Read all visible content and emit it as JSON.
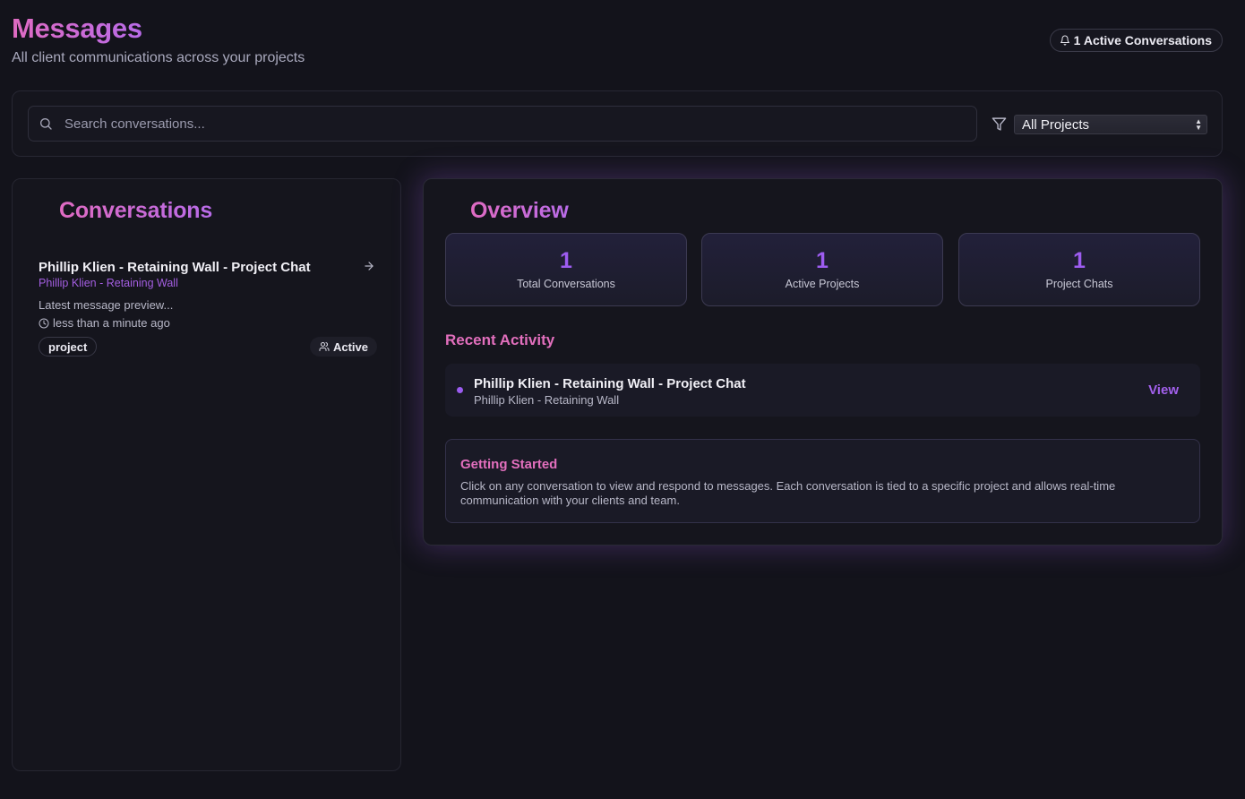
{
  "header": {
    "title": "Messages",
    "subtitle": "All client communications across your projects",
    "active_badge": "1 Active Conversations"
  },
  "search": {
    "placeholder": "Search conversations...",
    "value": "",
    "project_filter": {
      "selected": "All Projects"
    }
  },
  "conversations": {
    "title": "Conversations",
    "items": [
      {
        "title": "Phillip Klien - Retaining Wall - Project Chat",
        "project": "Phillip Klien - Retaining Wall",
        "preview": "Latest message preview...",
        "time": "less than a minute ago",
        "tag": "project",
        "status": "Active"
      }
    ]
  },
  "overview": {
    "title": "Overview",
    "stats": [
      {
        "value": "1",
        "label": "Total Conversations"
      },
      {
        "value": "1",
        "label": "Active Projects"
      },
      {
        "value": "1",
        "label": "Project Chats"
      }
    ],
    "recent_activity": {
      "heading": "Recent Activity",
      "items": [
        {
          "title": "Phillip Klien - Retaining Wall - Project Chat",
          "subtitle": "Phillip Klien - Retaining Wall",
          "action": "View"
        }
      ]
    },
    "getting_started": {
      "title": "Getting Started",
      "text": "Click on any conversation to view and respond to messages. Each conversation is tied to a specific project and allows real-time communication with your clients and team."
    }
  },
  "colors": {
    "background": "#13131b",
    "accent_pink": "#e26fbd",
    "accent_purple": "#9d5cf0"
  },
  "icons": {
    "badge": "bell-icon",
    "search": "search-icon",
    "filter": "filter-icon",
    "conversation_open": "arrow-right-icon",
    "time": "clock-icon",
    "status": "users-icon"
  }
}
